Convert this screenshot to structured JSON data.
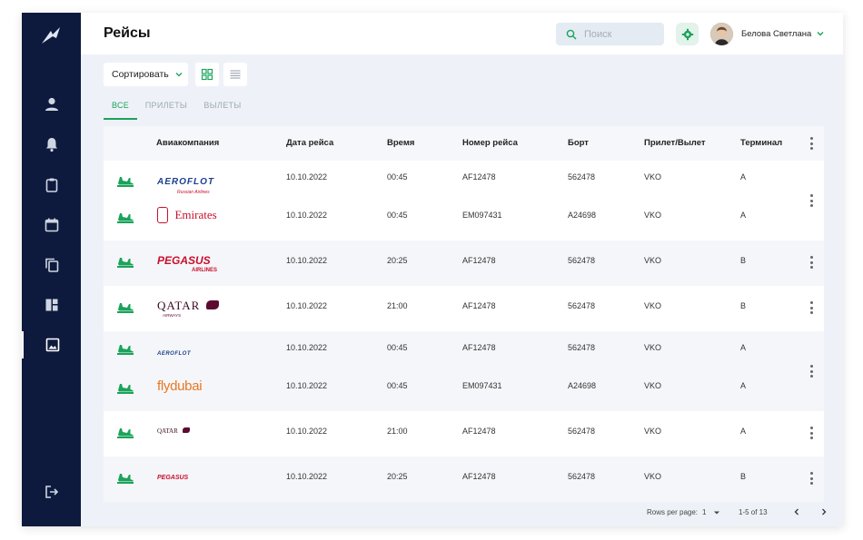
{
  "header": {
    "title": "Рейсы",
    "search_placeholder": "Поиск",
    "user_name": "Белова Светлана"
  },
  "toolbar": {
    "sort_label": "Сортировать"
  },
  "tabs": [
    "ВСЕ",
    "ПРИЛЕТЫ",
    "ВЫЛЕТЫ"
  ],
  "sidebar": {
    "items": [
      "user-icon",
      "bell-icon",
      "clipboard-icon",
      "calendar-icon",
      "copy-icon",
      "dashboard-icon",
      "image-icon",
      "logout-icon"
    ],
    "active": "image-icon"
  },
  "table": {
    "columns": [
      "Авиакомпания",
      "Дата рейса",
      "Время",
      "Номер рейса",
      "Борт",
      "Прилет/Вылет",
      "Терминал"
    ],
    "rows": [
      {
        "airline": "AEROFLOT",
        "airline_sub": "Russian Airlines",
        "date": "10.10.2022",
        "time": "00:45",
        "flight": "AF12478",
        "board": "562478",
        "airport": "VKO",
        "terminal": "A"
      },
      {
        "airline": "Emirates",
        "airline_sub": "",
        "date": "10.10.2022",
        "time": "00:45",
        "flight": "EM097431",
        "board": "A24698",
        "airport": "VKO",
        "terminal": "A"
      },
      {
        "airline": "PEGASUS",
        "airline_sub": "AIRLINES",
        "date": "10.10.2022",
        "time": "20:25",
        "flight": "AF12478",
        "board": "562478",
        "airport": "VKO",
        "terminal": "B"
      },
      {
        "airline": "QATAR",
        "airline_sub": "AIRWAYS",
        "date": "10.10.2022",
        "time": "21:00",
        "flight": "AF12478",
        "board": "562478",
        "airport": "VKO",
        "terminal": "B"
      },
      {
        "airline": "AEROFLOT",
        "airline_sub": "",
        "date": "10.10.2022",
        "time": "00:45",
        "flight": "AF12478",
        "board": "562478",
        "airport": "VKO",
        "terminal": "A"
      },
      {
        "airline": "flydubai",
        "airline_sub": "",
        "date": "10.10.2022",
        "time": "00:45",
        "flight": "EM097431",
        "board": "A24698",
        "airport": "VKO",
        "terminal": "A"
      },
      {
        "airline": "QATAR",
        "airline_sub": "",
        "date": "10.10.2022",
        "time": "21:00",
        "flight": "AF12478",
        "board": "562478",
        "airport": "VKO",
        "terminal": "A"
      },
      {
        "airline": "PEGASUS",
        "airline_sub": "",
        "date": "10.10.2022",
        "time": "20:25",
        "flight": "AF12478",
        "board": "562478",
        "airport": "VKO",
        "terminal": "B"
      }
    ]
  },
  "pagination": {
    "rows_per_page_label": "Rows per page:",
    "rows_per_page_value": "1",
    "range": "1-5 of 13"
  },
  "colors": {
    "accent": "#1aa35a",
    "sidebar": "#0e1a3d",
    "aeroflot": "#1c3f8f",
    "emirates": "#c8102e",
    "pegasus": "#c8102e",
    "qatar": "#5c0a32",
    "flydubai": "#e87722"
  }
}
